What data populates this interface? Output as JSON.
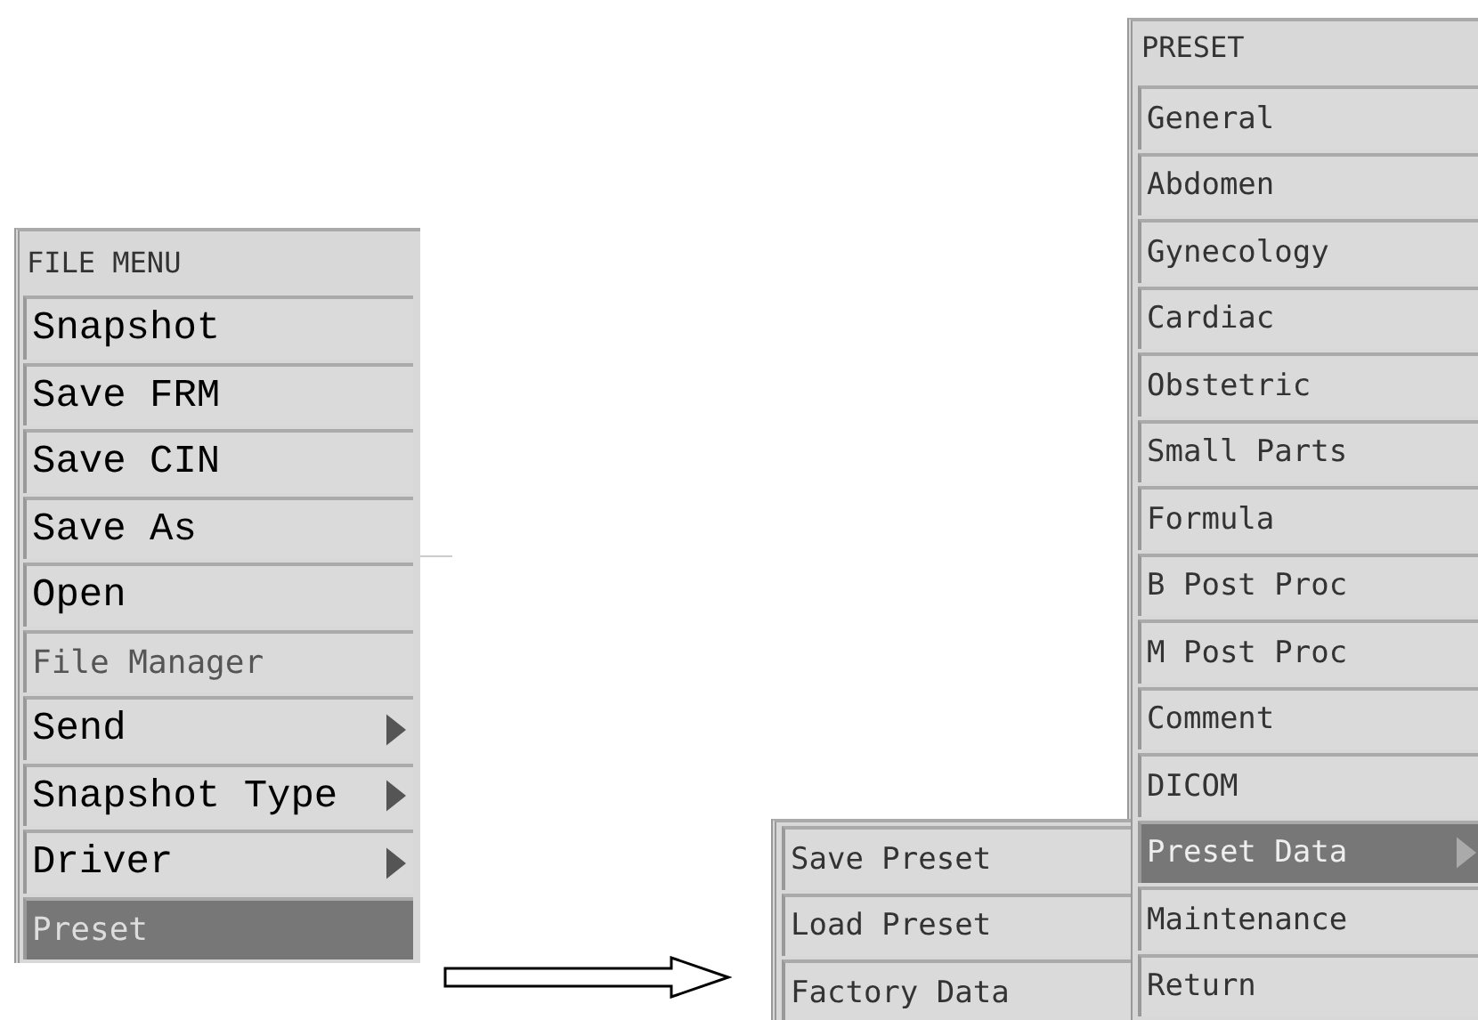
{
  "file_menu": {
    "title": "FILE MENU",
    "items": [
      {
        "label": "Snapshot",
        "kind": "large",
        "submenu": false,
        "selected": false
      },
      {
        "label": "Save FRM",
        "kind": "large",
        "submenu": false,
        "selected": false
      },
      {
        "label": "Save CIN",
        "kind": "large",
        "submenu": false,
        "selected": false
      },
      {
        "label": "Save As",
        "kind": "large",
        "submenu": false,
        "selected": false
      },
      {
        "label": "Open",
        "kind": "large",
        "submenu": false,
        "selected": false
      },
      {
        "label": "File Manager",
        "kind": "small",
        "submenu": false,
        "selected": false
      },
      {
        "label": "Send",
        "kind": "large",
        "submenu": true,
        "selected": false
      },
      {
        "label": "Snapshot Type",
        "kind": "large",
        "submenu": true,
        "selected": false
      },
      {
        "label": "Driver",
        "kind": "large",
        "submenu": true,
        "selected": false
      },
      {
        "label": "Preset",
        "kind": "small",
        "submenu": false,
        "selected": true
      }
    ]
  },
  "preset_menu": {
    "title": "PRESET",
    "items": [
      {
        "label": "General",
        "submenu": false,
        "selected": false
      },
      {
        "label": "Abdomen",
        "submenu": false,
        "selected": false
      },
      {
        "label": "Gynecology",
        "submenu": false,
        "selected": false
      },
      {
        "label": "Cardiac",
        "submenu": false,
        "selected": false
      },
      {
        "label": "Obstetric",
        "submenu": false,
        "selected": false
      },
      {
        "label": "Small Parts",
        "submenu": false,
        "selected": false
      },
      {
        "label": "Formula",
        "submenu": false,
        "selected": false
      },
      {
        "label": "B Post Proc",
        "submenu": false,
        "selected": false
      },
      {
        "label": "M Post Proc",
        "submenu": false,
        "selected": false
      },
      {
        "label": "Comment",
        "submenu": false,
        "selected": false
      },
      {
        "label": "DICOM",
        "submenu": false,
        "selected": false
      },
      {
        "label": "Preset Data",
        "submenu": true,
        "selected": true
      },
      {
        "label": "Maintenance",
        "submenu": false,
        "selected": false
      },
      {
        "label": "Return",
        "submenu": false,
        "selected": false
      }
    ]
  },
  "preset_data_menu": {
    "items": [
      {
        "label": "Save Preset",
        "selected": false
      },
      {
        "label": "Load Preset",
        "selected": false
      },
      {
        "label": "Factory Data",
        "selected": false
      }
    ]
  }
}
